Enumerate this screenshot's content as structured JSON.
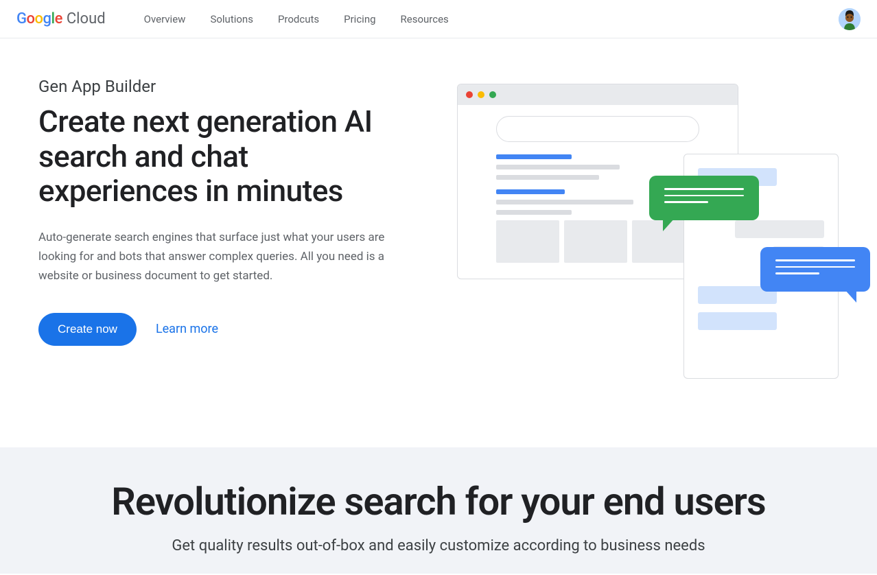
{
  "header": {
    "logo_cloud": "Cloud",
    "nav": [
      "Overview",
      "Solutions",
      "Prodcuts",
      "Pricing",
      "Resources"
    ]
  },
  "hero": {
    "eyebrow": "Gen App Builder",
    "title": "Create next generation AI search and chat experiences in minutes",
    "description": "Auto-generate search engines that surface just what your users are looking for and bots that answer complex queries. All you need is a website or business document to get started.",
    "cta_primary": "Create now",
    "cta_secondary": "Learn more"
  },
  "section2": {
    "title": "Revolutionize search for your end users",
    "subtitle": "Get quality results out-of-box and easily customize according to business needs"
  }
}
